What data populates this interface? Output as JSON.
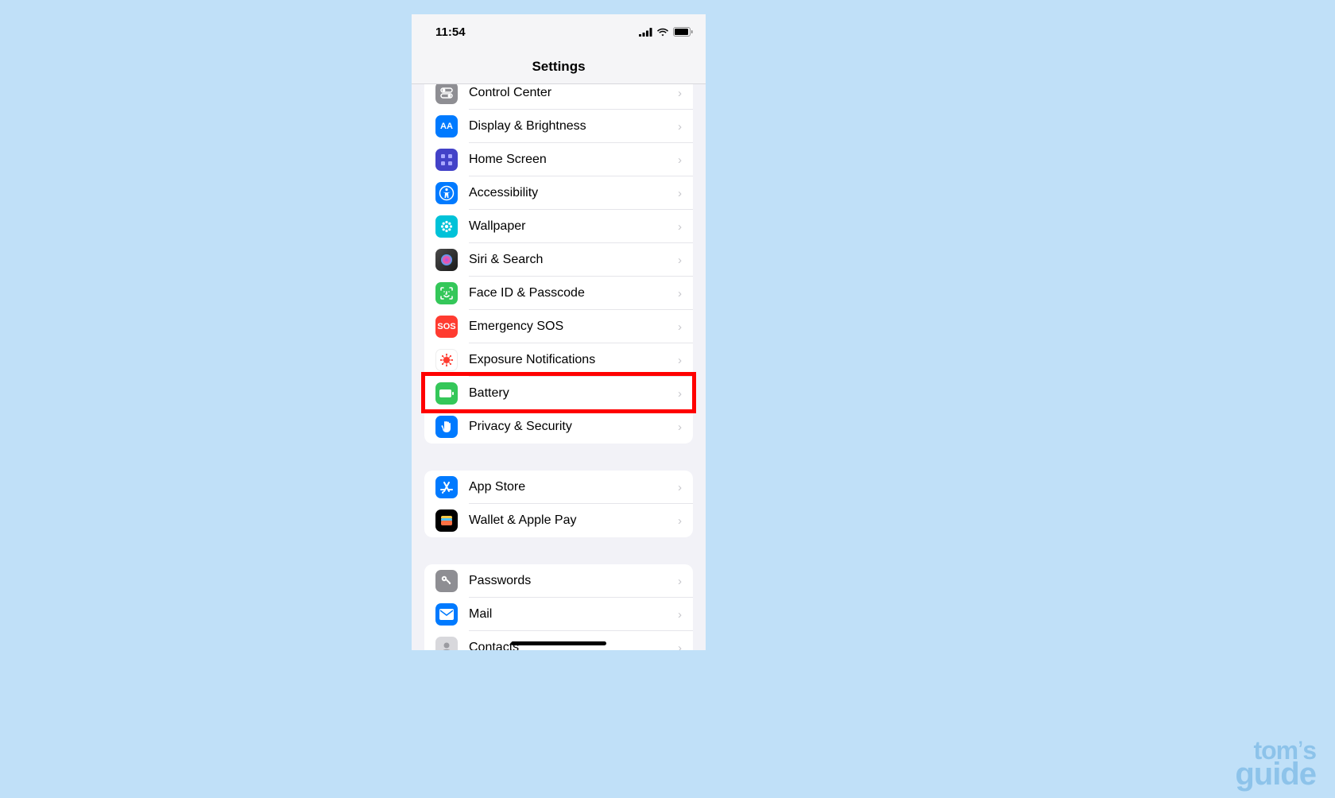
{
  "status": {
    "time": "11:54"
  },
  "header": {
    "title": "Settings"
  },
  "groups": [
    {
      "id": "g1",
      "rows": [
        {
          "id": "control-center",
          "label": "Control Center",
          "icon": "toggles-icon",
          "icon_bg": "ic-control"
        },
        {
          "id": "display",
          "label": "Display & Brightness",
          "icon": "text-size-icon",
          "icon_bg": "ic-display",
          "icon_text": "AA"
        },
        {
          "id": "home-screen",
          "label": "Home Screen",
          "icon": "grid-icon",
          "icon_bg": "ic-home"
        },
        {
          "id": "accessibility",
          "label": "Accessibility",
          "icon": "accessibility-icon",
          "icon_bg": "ic-access"
        },
        {
          "id": "wallpaper",
          "label": "Wallpaper",
          "icon": "flower-icon",
          "icon_bg": "ic-wall"
        },
        {
          "id": "siri",
          "label": "Siri & Search",
          "icon": "siri-icon",
          "icon_bg": "ic-siri"
        },
        {
          "id": "faceid",
          "label": "Face ID & Passcode",
          "icon": "faceid-icon",
          "icon_bg": "ic-faceid"
        },
        {
          "id": "sos",
          "label": "Emergency SOS",
          "icon": "sos-icon",
          "icon_bg": "ic-sos",
          "icon_text": "SOS"
        },
        {
          "id": "exposure",
          "label": "Exposure Notifications",
          "icon": "virus-icon",
          "icon_bg": "ic-expo"
        },
        {
          "id": "battery",
          "label": "Battery",
          "icon": "battery-icon",
          "icon_bg": "ic-batt",
          "highlight": true
        },
        {
          "id": "privacy",
          "label": "Privacy & Security",
          "icon": "hand-icon",
          "icon_bg": "ic-priv"
        }
      ]
    },
    {
      "id": "g2",
      "rows": [
        {
          "id": "appstore",
          "label": "App Store",
          "icon": "appstore-icon",
          "icon_bg": "ic-store"
        },
        {
          "id": "wallet",
          "label": "Wallet & Apple Pay",
          "icon": "wallet-icon",
          "icon_bg": "ic-wallet"
        }
      ]
    },
    {
      "id": "g3",
      "rows": [
        {
          "id": "passwords",
          "label": "Passwords",
          "icon": "key-icon",
          "icon_bg": "ic-pass"
        },
        {
          "id": "mail",
          "label": "Mail",
          "icon": "mail-icon",
          "icon_bg": "ic-mail"
        },
        {
          "id": "contacts",
          "label": "Contacts",
          "icon": "contact-icon",
          "icon_bg": "ic-contact"
        }
      ]
    }
  ],
  "watermark": {
    "line1": "tom",
    "apos": "’",
    "s": "s",
    "line2": "guide"
  }
}
